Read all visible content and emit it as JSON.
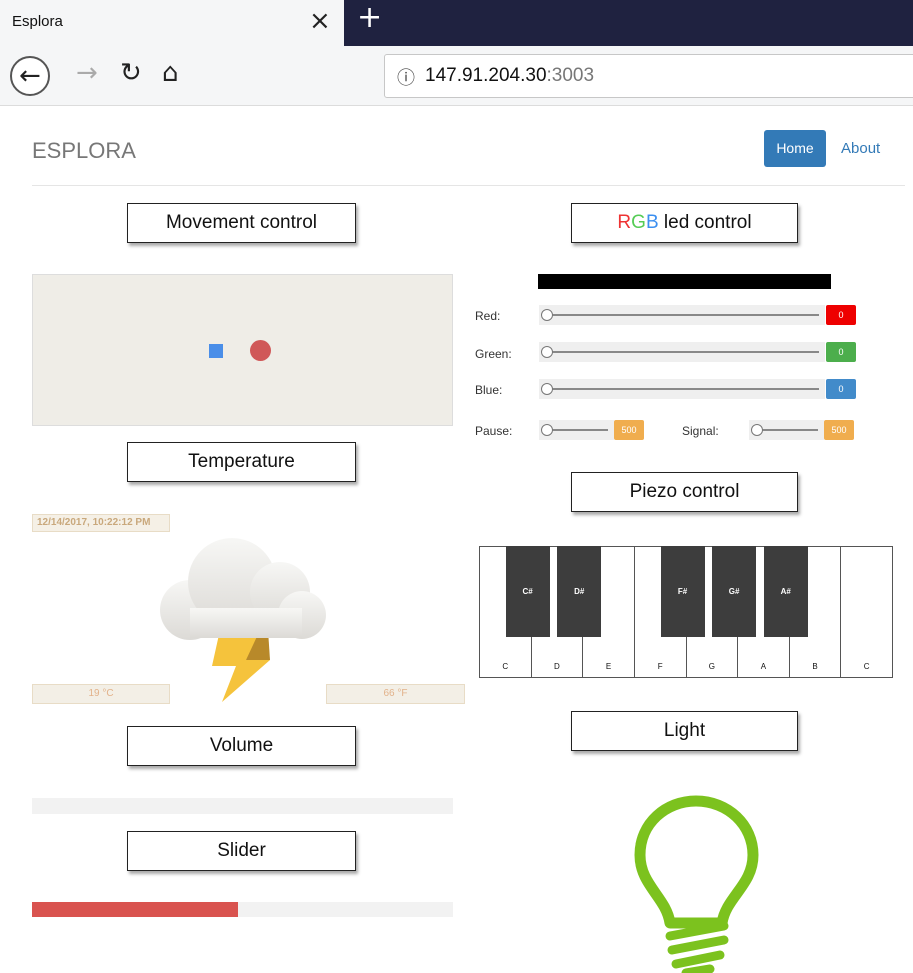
{
  "browser": {
    "tab_title": "Esplora",
    "tab_close_icon": "×",
    "new_tab_icon": "+",
    "url_host": "147.91.204.30",
    "url_port": ":3003",
    "info_icon": "ⓘ"
  },
  "header": {
    "brand": "ESPLORA",
    "nav": {
      "home": "Home",
      "about": "About"
    }
  },
  "sections": {
    "movement": "Movement control",
    "rgb_r": "R",
    "rgb_g": "G",
    "rgb_b": "B",
    "rgb_rest": " led control",
    "temperature": "Temperature",
    "piezo": "Piezo control",
    "volume": "Volume",
    "light": "Light",
    "slider": "Slider"
  },
  "temperature": {
    "timestamp": "12/14/2017, 10:22:12 PM",
    "celsius": "19 °C",
    "fahrenheit": "66 °F"
  },
  "rgb_controls": {
    "red": {
      "label": "Red:",
      "value": "0",
      "color": "#ee0000"
    },
    "green": {
      "label": "Green:",
      "value": "0",
      "color": "#4cae4c"
    },
    "blue": {
      "label": "Blue:",
      "value": "0",
      "color": "#428bca"
    },
    "pause": {
      "label": "Pause:",
      "value": "500",
      "color": "#f0ad4e"
    },
    "signal": {
      "label": "Signal:",
      "value": "500",
      "color": "#f0ad4e"
    }
  },
  "piano": {
    "white_keys": [
      "C",
      "D",
      "E",
      "F",
      "G",
      "A",
      "B",
      "C"
    ],
    "black_keys": [
      "C#",
      "D#",
      "F#",
      "G#",
      "A#"
    ]
  },
  "volume_level": 0,
  "slider_level": 0.49,
  "colors": {
    "brand_blue": "#337ab7",
    "bulb_green": "#7cc21e",
    "slider_red": "#d9534f"
  }
}
